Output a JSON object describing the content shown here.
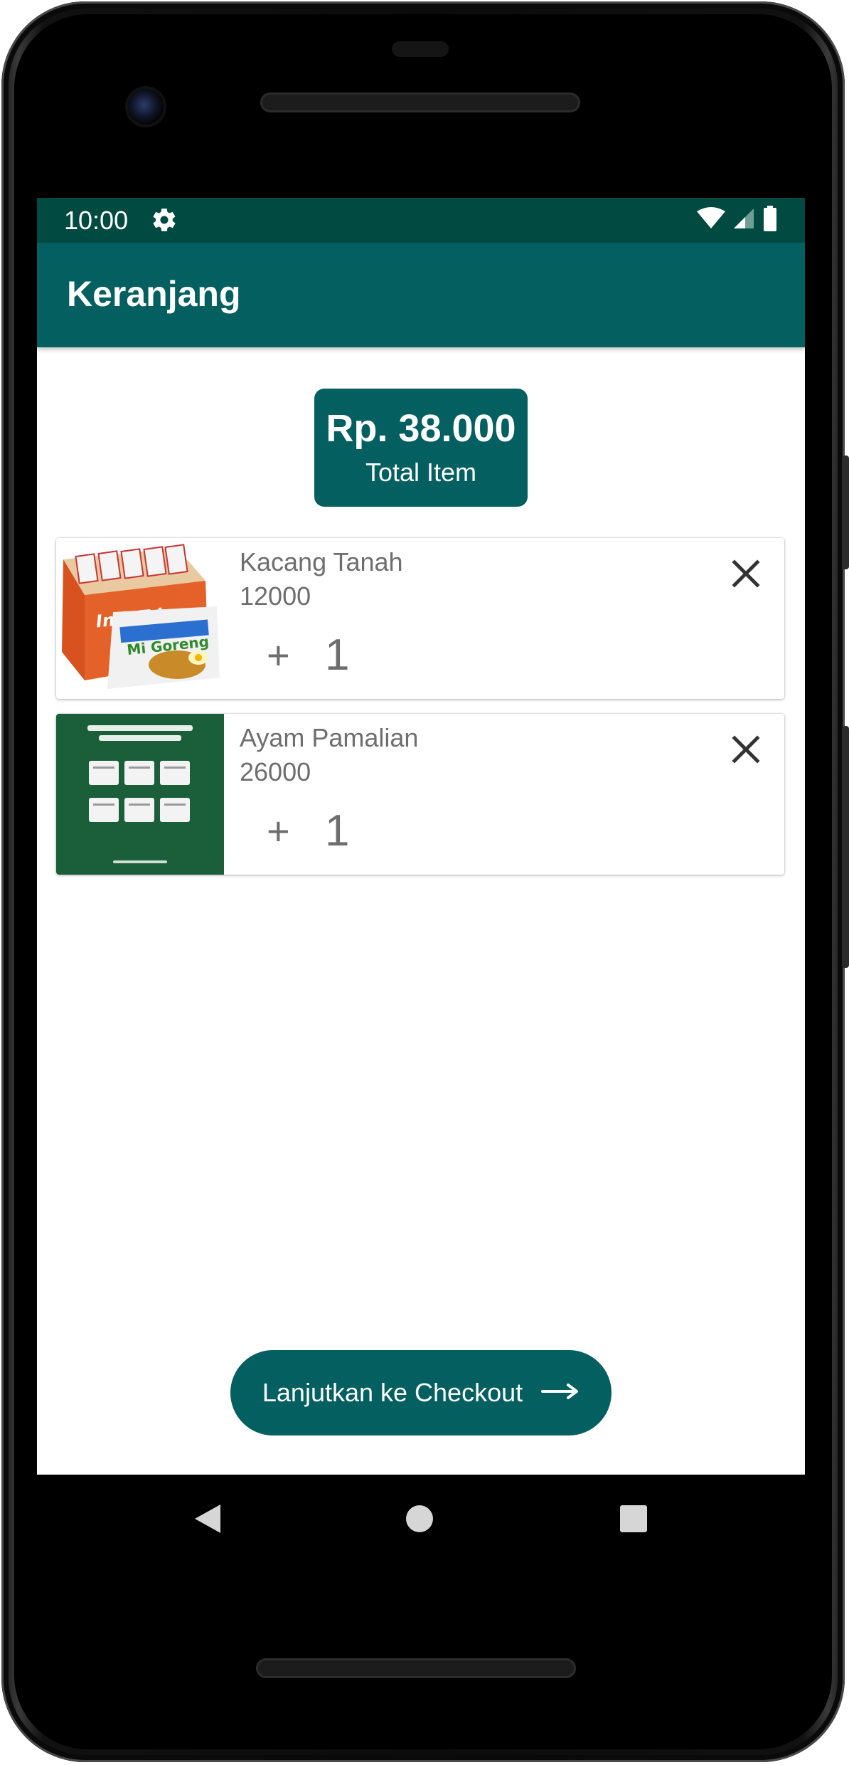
{
  "status_bar": {
    "time": "10:00",
    "settings_icon": "gear-icon",
    "icons": [
      "wifi-icon",
      "signal-icon",
      "battery-icon"
    ]
  },
  "app_bar": {
    "title": "Keranjang"
  },
  "total": {
    "amount": "Rp. 38.000",
    "label": "Total Item"
  },
  "cart": {
    "items": [
      {
        "name": "Kacang Tanah",
        "price": "12000",
        "increment_symbol": "+",
        "quantity": "1",
        "remove_icon": "close-icon",
        "thumbnail": "product-image-noodle-box"
      },
      {
        "name": "Ayam Pamalian",
        "price": "26000",
        "increment_symbol": "+",
        "quantity": "1",
        "remove_icon": "close-icon",
        "thumbnail": "product-image-website-screenshot"
      }
    ]
  },
  "checkout": {
    "label": "Lanjutkan ke Checkout",
    "icon": "arrow-right-icon"
  },
  "nav_bar": {
    "icons": [
      "back-icon",
      "home-icon",
      "recents-icon"
    ]
  },
  "colors": {
    "status_bar": "#014a42",
    "primary": "#035f60",
    "text_secondary": "#6e6e6e",
    "thumb_green": "#1a5e3a"
  }
}
